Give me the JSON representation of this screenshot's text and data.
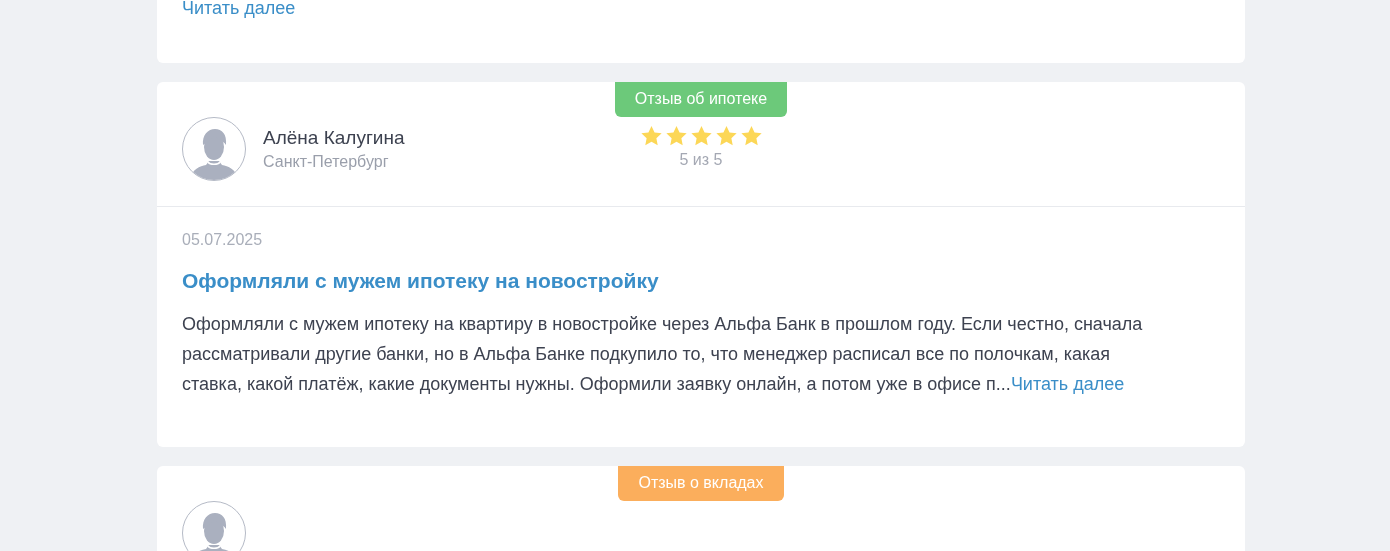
{
  "previous_review": {
    "read_more": "Читать далее"
  },
  "reviews": [
    {
      "badge": "Отзыв об ипотеке",
      "color": "#6cc97a",
      "name": "Алёна Калугина",
      "city": "Санкт-Петербург",
      "stars": 5,
      "rating_text": "5 из 5",
      "date": "05.07.2025",
      "title": "Оформляли с мужем ипотеку на новостройку",
      "text": "Оформляли с мужем ипотеку на квартиру в новостройке через Альфа Банк в прошлом году. Если честно, сначала рассматривали другие банки, но в Альфа Банке подкупило то, что менеджер расписал все по полочкам, какая ставка, какой платёж, какие документы нужны. Оформили заявку онлайн, а потом уже в офисе п...",
      "read_more": "Читать далее"
    },
    {
      "badge": "Отзыв о вкладах",
      "color": "#fbae5c"
    }
  ]
}
